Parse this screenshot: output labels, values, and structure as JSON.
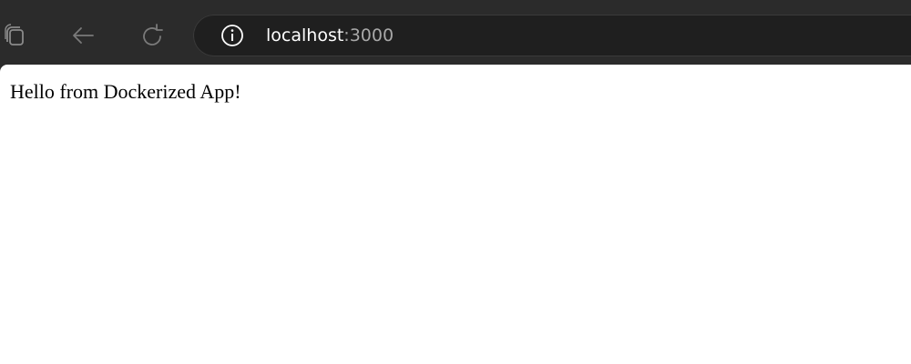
{
  "browser": {
    "toolbar": {
      "tabs_icon": "tab-collection-icon",
      "back_icon": "back-arrow-icon",
      "refresh_icon": "refresh-icon"
    },
    "address_bar": {
      "info_icon": "info-icon",
      "host": "localhost",
      "port": ":3000"
    }
  },
  "page": {
    "text": "Hello from Dockerized App!"
  },
  "colors": {
    "chrome_background": "#2b2b2b",
    "address_bar_background": "#1f1f1f",
    "url_host": "#ffffff",
    "url_port": "#a8a8a8",
    "page_background": "#ffffff"
  }
}
